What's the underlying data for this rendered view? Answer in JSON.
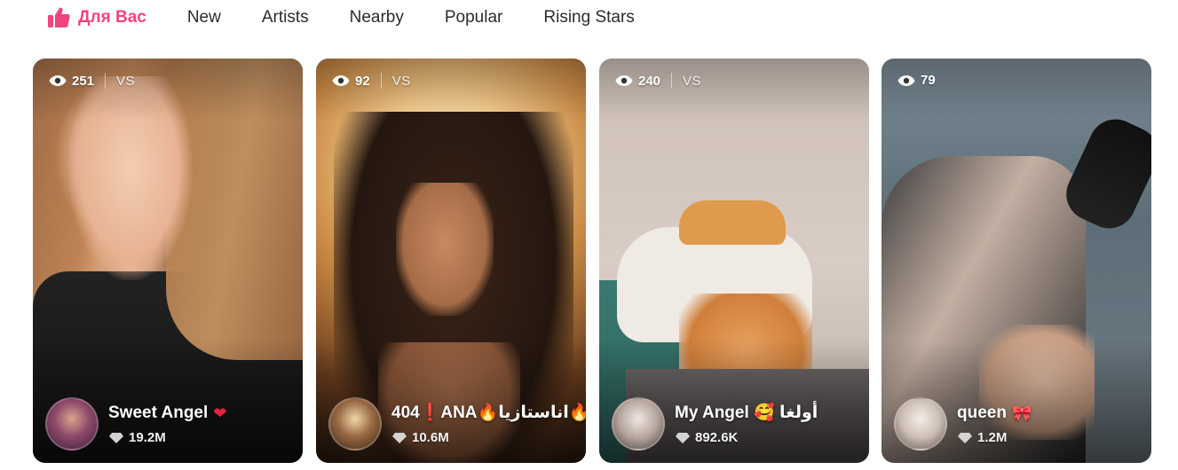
{
  "tabs": [
    {
      "label": "Для Вас",
      "active": true
    },
    {
      "label": "New"
    },
    {
      "label": "Artists"
    },
    {
      "label": "Nearby"
    },
    {
      "label": "Popular"
    },
    {
      "label": "Rising Stars"
    }
  ],
  "accent_color": "#f0457c",
  "cards": [
    {
      "viewers": "251",
      "vs": "VS",
      "name": "Sweet Angel",
      "emoji": "❤",
      "followers": "19.2M"
    },
    {
      "viewers": "92",
      "vs": "VS",
      "name": "404❗ANA🔥اناستازيا🔥",
      "emoji": "",
      "followers": "10.6M"
    },
    {
      "viewers": "240",
      "vs": "VS",
      "name": "My Angel 🥰 أولغا",
      "emoji": "",
      "followers": "892.6K"
    },
    {
      "viewers": "79",
      "vs": "",
      "name": "queen",
      "emoji": "🎀",
      "followers": "1.2M"
    }
  ]
}
